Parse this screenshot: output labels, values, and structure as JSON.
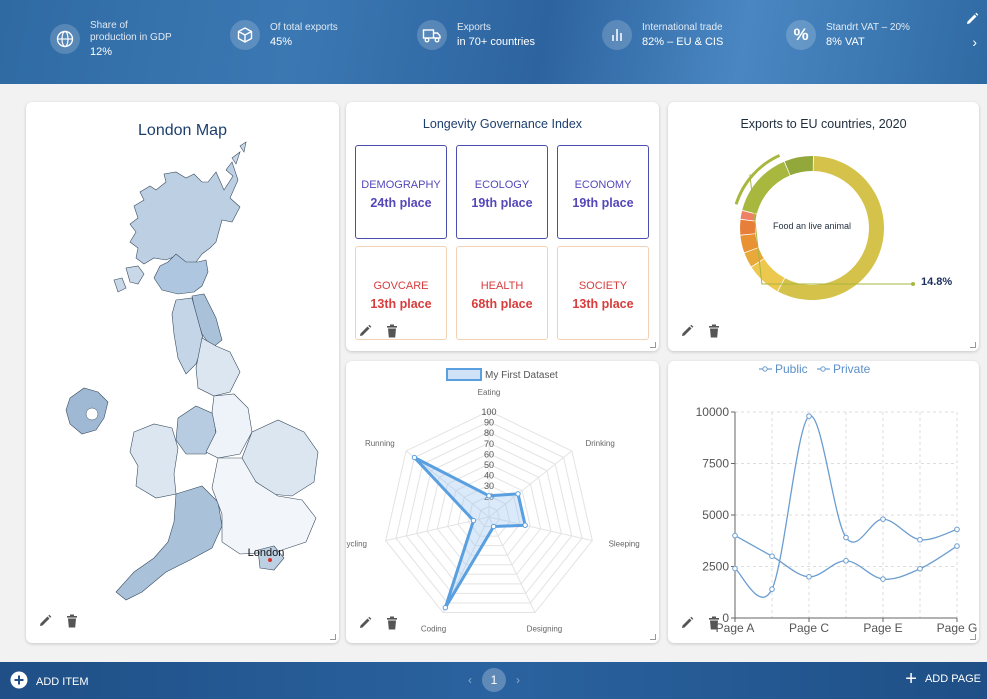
{
  "header": {
    "stats": [
      {
        "label": "Share of production in GDP",
        "value": "12%",
        "icon": "globe-icon"
      },
      {
        "label": "Of total exports",
        "value": "45%",
        "icon": "box-icon"
      },
      {
        "label": "Exports",
        "value": "in 70+ countries",
        "icon": "truck-icon"
      },
      {
        "label": "International trade",
        "value": "82% – EU & CIS",
        "icon": "bar-chart-icon"
      },
      {
        "label": "Standrt VAT – 20%",
        "value": "8% VAT",
        "icon": "percent-icon"
      }
    ]
  },
  "map_card": {
    "title": "London Map",
    "marker_label": "London"
  },
  "index_card": {
    "title": "Longevity Governance Index",
    "tiles": [
      {
        "name": "DEMOGRAPHY",
        "place": "24th place",
        "tone": "blue"
      },
      {
        "name": "ECOLOGY",
        "place": "19th place",
        "tone": "blue"
      },
      {
        "name": "ECONOMY",
        "place": "19th place",
        "tone": "blue"
      },
      {
        "name": "GOVCARE",
        "place": "13th place",
        "tone": "red"
      },
      {
        "name": "HEALTH",
        "place": "68th place",
        "tone": "red"
      },
      {
        "name": "SOCIETY",
        "place": "13th place",
        "tone": "red"
      }
    ]
  },
  "donut_card": {
    "title": "Exports to EU countries, 2020",
    "center_label": "Food an live animal",
    "callout": "14.8%"
  },
  "chart_data": [
    {
      "type": "pie",
      "title": "Exports to EU countries, 2020",
      "labels": [
        "Food an live animal"
      ],
      "values": [
        57.6,
        8,
        3.5,
        4,
        3.5,
        2,
        14.8,
        6.6
      ],
      "colors": [
        "#d4c24a",
        "#ecc84f",
        "#e9a93a",
        "#e89234",
        "#e77e3a",
        "#ee8066",
        "#a8b73e",
        "#93a83a"
      ],
      "callout": "14.8%"
    },
    {
      "type": "radar",
      "legend": "My First Dataset",
      "categories": [
        "Eating",
        "Drinking",
        "Sleeping",
        "Designing",
        "Coding",
        "Cycling",
        "Running"
      ],
      "values": [
        20,
        35,
        35,
        10,
        95,
        15,
        90
      ],
      "r_ticks": [
        20,
        30,
        40,
        50,
        60,
        70,
        80,
        90,
        100
      ],
      "r_max": 100,
      "color": "#5a9fe0"
    },
    {
      "type": "line",
      "x_tick_labels": [
        "Page A",
        "Page C",
        "Page E",
        "Page G"
      ],
      "x": [
        "Page A",
        "Page B",
        "Page C",
        "Page D",
        "Page E",
        "Page F",
        "Page G"
      ],
      "series": [
        {
          "name": "Public",
          "values": [
            4000,
            3000,
            2000,
            2780,
            1890,
            2390,
            3490
          ]
        },
        {
          "name": "Private",
          "values": [
            2400,
            1398,
            9800,
            3908,
            4800,
            3800,
            4300
          ]
        }
      ],
      "y_ticks": [
        0,
        2500,
        5000,
        7500,
        10000
      ],
      "ylim": [
        0,
        10000
      ],
      "grid": true,
      "legend_position": "top-center"
    }
  ],
  "footer": {
    "add_item": "ADD ITEM",
    "page": "1",
    "add_page": "ADD PAGE"
  }
}
